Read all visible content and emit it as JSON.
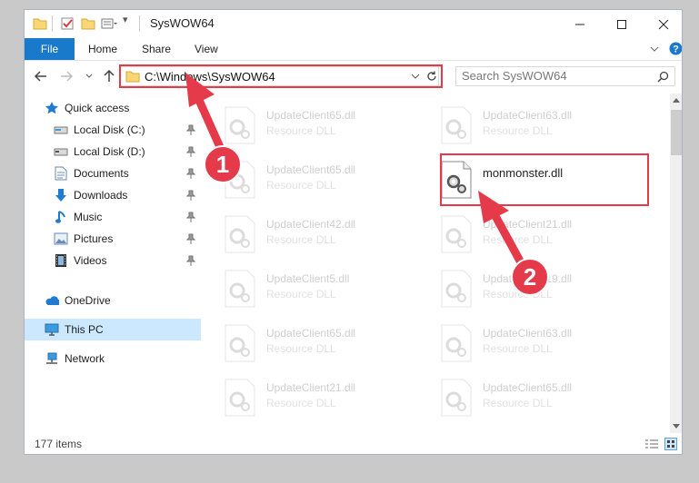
{
  "window": {
    "title": "SysWOW64"
  },
  "ribbon": {
    "tabs": [
      "File",
      "Home",
      "Share",
      "View"
    ]
  },
  "address": {
    "path": "C:\\Windows\\SysWOW64"
  },
  "search": {
    "placeholder": "Search SysWOW64"
  },
  "sidebar": {
    "items": [
      {
        "label": "Quick access",
        "icon": "star-icon"
      },
      {
        "label": "Local Disk (C:)",
        "icon": "drive-icon",
        "pinned": true
      },
      {
        "label": "Local Disk (D:)",
        "icon": "drive-icon",
        "pinned": true
      },
      {
        "label": "Documents",
        "icon": "documents-icon",
        "pinned": true
      },
      {
        "label": "Downloads",
        "icon": "download-icon",
        "pinned": true
      },
      {
        "label": "Music",
        "icon": "music-icon",
        "pinned": true
      },
      {
        "label": "Pictures",
        "icon": "pictures-icon",
        "pinned": true
      },
      {
        "label": "Videos",
        "icon": "videos-icon",
        "pinned": true
      },
      {
        "label": "OneDrive",
        "icon": "cloud-icon"
      },
      {
        "label": "This PC",
        "icon": "computer-icon",
        "selected": true
      },
      {
        "label": "Network",
        "icon": "network-icon"
      }
    ]
  },
  "files": [
    {
      "name": "UpdateClient65.dll",
      "type": "Resource DLL"
    },
    {
      "name": "UpdateClient63.dll",
      "type": "Resource DLL"
    },
    {
      "name": "UpdateClient65.dll",
      "type": "Resource DLL"
    },
    {
      "name": "monmonster.dll",
      "type": ""
    },
    {
      "name": "UpdateClient42.dll",
      "type": "Resource DLL"
    },
    {
      "name": "UpdateClient21.dll",
      "type": "Resource DLL"
    },
    {
      "name": "UpdateClient5.dll",
      "type": "Resource DLL"
    },
    {
      "name": "UpdateClient19.dll",
      "type": "Resource DLL"
    },
    {
      "name": "UpdateClient65.dll",
      "type": "Resource DLL"
    },
    {
      "name": "UpdateClient63.dll",
      "type": "Resource DLL"
    },
    {
      "name": "UpdateClient21.dll",
      "type": "Resource DLL"
    },
    {
      "name": "UpdateClient65.dll",
      "type": "Resource DLL"
    }
  ],
  "status": {
    "item_count": "177 items"
  },
  "annotations": {
    "step1": "1",
    "step2": "2",
    "color": "#e53a4a"
  }
}
